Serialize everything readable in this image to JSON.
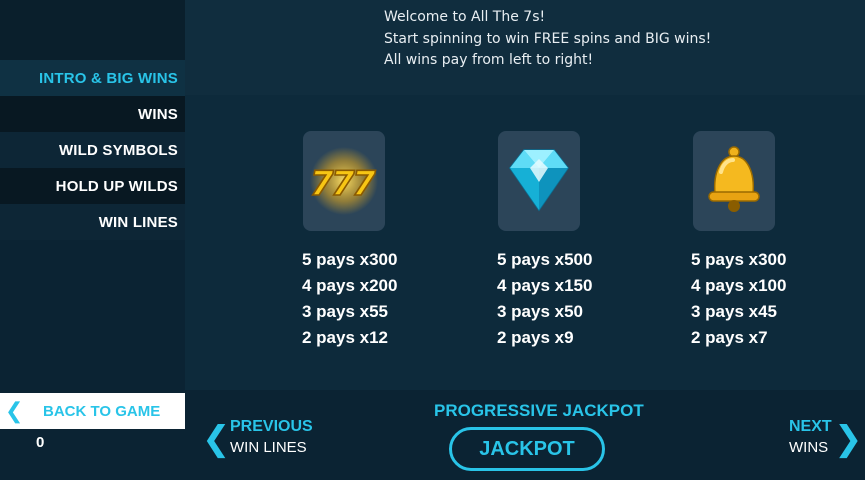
{
  "header": {
    "lines": [
      "Welcome to All The 7s!",
      "Start spinning to win FREE spins and BIG wins!",
      "All wins pay from left to right!"
    ]
  },
  "sidebar": {
    "items": [
      {
        "label": "INTRO & BIG WINS",
        "active": true
      },
      {
        "label": "WINS",
        "active": false
      },
      {
        "label": "WILD SYMBOLS",
        "active": false
      },
      {
        "label": "HOLD UP WILDS",
        "active": false
      },
      {
        "label": "WIN LINES",
        "active": false
      }
    ],
    "back_label": "BACK TO GAME",
    "balance": "0"
  },
  "symbols": [
    {
      "icon": "triple-seven-icon",
      "pays": [
        "5 pays x300",
        "4 pays x200",
        "3 pays x55",
        "2 pays x12"
      ]
    },
    {
      "icon": "diamond-icon",
      "pays": [
        "5 pays x500",
        "4 pays x150",
        "3 pays x50",
        "2 pays x9"
      ]
    },
    {
      "icon": "bell-icon",
      "pays": [
        "5 pays x300",
        "4 pays x100",
        "3 pays x45",
        "2 pays x7"
      ]
    }
  ],
  "footer": {
    "previous_title": "PREVIOUS",
    "previous_sub": "WIN LINES",
    "next_title": "NEXT",
    "next_sub": "WINS",
    "jackpot_title": "PROGRESSIVE JACKPOT",
    "jackpot_button": "JACKPOT"
  },
  "colors": {
    "accent": "#29c4e8",
    "background": "#0b2333"
  }
}
